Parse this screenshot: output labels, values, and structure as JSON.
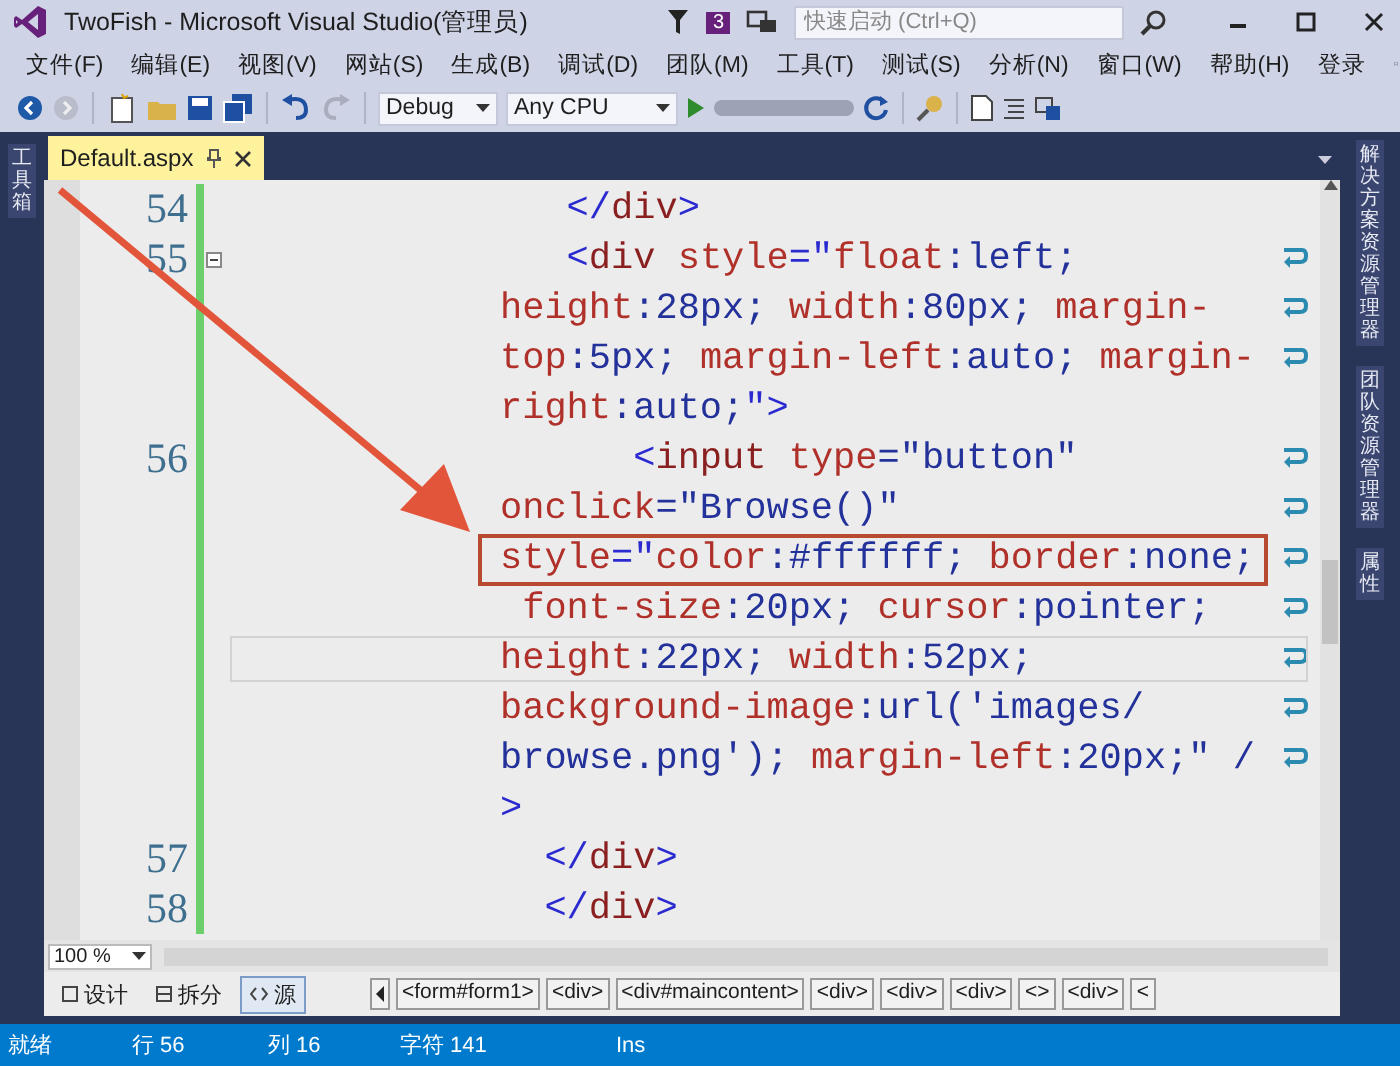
{
  "window": {
    "title": "TwoFish - Microsoft Visual Studio(管理员)",
    "notification_count": "3",
    "quick_launch": {
      "placeholder": "快速启动 (Ctrl+Q)"
    }
  },
  "menu": [
    "文件(F)",
    "编辑(E)",
    "视图(V)",
    "网站(S)",
    "生成(B)",
    "调试(D)",
    "团队(M)",
    "工具(T)",
    "测试(S)",
    "分析(N)",
    "窗口(W)",
    "帮助(H)"
  ],
  "sign_in": "登录",
  "toolbar": {
    "configuration": "Debug",
    "platform": "Any CPU"
  },
  "left_panel_tabs": [
    "工具箱"
  ],
  "right_panel_tabs": [
    "解决方案资源管理器",
    "团队资源管理器",
    "属性"
  ],
  "document_tab": {
    "label": "Default.aspx"
  },
  "code_rows": [
    {
      "number": "54",
      "fold": false,
      "wrap": false,
      "current": false,
      "annotated": false,
      "segments": [
        {
          "text": "   </",
          "kind": "delim"
        },
        {
          "text": "div",
          "kind": "tag"
        },
        {
          "text": ">",
          "kind": "delim"
        }
      ]
    },
    {
      "number": "55",
      "fold": true,
      "wrap": true,
      "current": false,
      "annotated": false,
      "segments": [
        {
          "text": "   <",
          "kind": "delim"
        },
        {
          "text": "div",
          "kind": "tag"
        },
        {
          "text": " style",
          "kind": "attr"
        },
        {
          "text": "=\"",
          "kind": "delim"
        },
        {
          "text": "float",
          "kind": "attr"
        },
        {
          "text": ":left;",
          "kind": "value"
        }
      ]
    },
    {
      "fold": false,
      "wrap": true,
      "current": false,
      "annotated": false,
      "segments": [
        {
          "text": "height",
          "kind": "attr"
        },
        {
          "text": ":28px; ",
          "kind": "value"
        },
        {
          "text": "width",
          "kind": "attr"
        },
        {
          "text": ":80px; ",
          "kind": "value"
        },
        {
          "text": "margin-",
          "kind": "attr"
        }
      ]
    },
    {
      "fold": false,
      "wrap": true,
      "current": false,
      "annotated": false,
      "segments": [
        {
          "text": "top",
          "kind": "attr"
        },
        {
          "text": ":5px; ",
          "kind": "value"
        },
        {
          "text": "margin-left",
          "kind": "attr"
        },
        {
          "text": ":auto; ",
          "kind": "value"
        },
        {
          "text": "margin-",
          "kind": "attr"
        }
      ]
    },
    {
      "fold": false,
      "wrap": false,
      "current": false,
      "annotated": false,
      "segments": [
        {
          "text": "right",
          "kind": "attr"
        },
        {
          "text": ":auto;",
          "kind": "value"
        },
        {
          "text": "\">",
          "kind": "delim"
        }
      ]
    },
    {
      "number": "56",
      "fold": false,
      "wrap": true,
      "current": false,
      "annotated": false,
      "segments": [
        {
          "text": "      <",
          "kind": "delim"
        },
        {
          "text": "input",
          "kind": "tag"
        },
        {
          "text": " type",
          "kind": "attr"
        },
        {
          "text": "=\"button\"",
          "kind": "value"
        }
      ]
    },
    {
      "fold": false,
      "wrap": true,
      "current": false,
      "annotated": false,
      "segments": [
        {
          "text": "onclick",
          "kind": "attr"
        },
        {
          "text": "=\"Browse()\"",
          "kind": "value"
        }
      ]
    },
    {
      "fold": false,
      "wrap": true,
      "current": false,
      "annotated": true,
      "segments": [
        {
          "text": "style",
          "kind": "attr"
        },
        {
          "text": "=\"",
          "kind": "delim"
        },
        {
          "text": "color",
          "kind": "attr"
        },
        {
          "text": ":#ffffff; ",
          "kind": "value"
        },
        {
          "text": "border",
          "kind": "attr"
        },
        {
          "text": ":none;",
          "kind": "value"
        }
      ]
    },
    {
      "fold": false,
      "wrap": true,
      "current": false,
      "annotated": false,
      "segments": [
        {
          "text": " font-size",
          "kind": "attr"
        },
        {
          "text": ":20px; ",
          "kind": "value"
        },
        {
          "text": "cursor",
          "kind": "attr"
        },
        {
          "text": ":pointer;",
          "kind": "value"
        }
      ]
    },
    {
      "fold": false,
      "wrap": true,
      "current": true,
      "annotated": false,
      "segments": [
        {
          "text": "height",
          "kind": "attr"
        },
        {
          "text": ":22px; ",
          "kind": "value"
        },
        {
          "text": "width",
          "kind": "attr"
        },
        {
          "text": ":52px;",
          "kind": "value"
        }
      ]
    },
    {
      "fold": false,
      "wrap": true,
      "current": false,
      "annotated": false,
      "segments": [
        {
          "text": "background-image",
          "kind": "attr"
        },
        {
          "text": ":url('images/",
          "kind": "value"
        }
      ]
    },
    {
      "fold": false,
      "wrap": true,
      "current": false,
      "annotated": false,
      "segments": [
        {
          "text": "browse.png'); ",
          "kind": "value"
        },
        {
          "text": "margin-left",
          "kind": "attr"
        },
        {
          "text": ":20px;\" /",
          "kind": "value"
        }
      ]
    },
    {
      "fold": false,
      "wrap": false,
      "current": false,
      "annotated": false,
      "segments": [
        {
          "text": ">",
          "kind": "delim"
        }
      ]
    },
    {
      "number": "57",
      "fold": false,
      "wrap": false,
      "current": false,
      "annotated": false,
      "segments": [
        {
          "text": "  </",
          "kind": "delim"
        },
        {
          "text": "div",
          "kind": "tag"
        },
        {
          "text": ">",
          "kind": "delim"
        }
      ]
    },
    {
      "number": "58",
      "fold": false,
      "wrap": false,
      "current": false,
      "annotated": false,
      "segments": [
        {
          "text": "  </",
          "kind": "delim"
        },
        {
          "text": "div",
          "kind": "tag"
        },
        {
          "text": ">",
          "kind": "delim"
        }
      ]
    }
  ],
  "zoom": "100 %",
  "view_buttons": [
    {
      "label": "设计",
      "kind": "design",
      "selected": false
    },
    {
      "label": "拆分",
      "kind": "split",
      "selected": false
    },
    {
      "label": "源",
      "kind": "source",
      "selected": true
    }
  ],
  "breadcrumbs": [
    "<form#form1>",
    "<div>",
    "<div#maincontent>",
    "<div>",
    "<div>",
    "<div>",
    "<>",
    "<div>",
    "<"
  ],
  "status_bar": {
    "state": "就绪",
    "line": "行 56",
    "column": "列 16",
    "char": "字符 141",
    "mode": "Ins"
  }
}
